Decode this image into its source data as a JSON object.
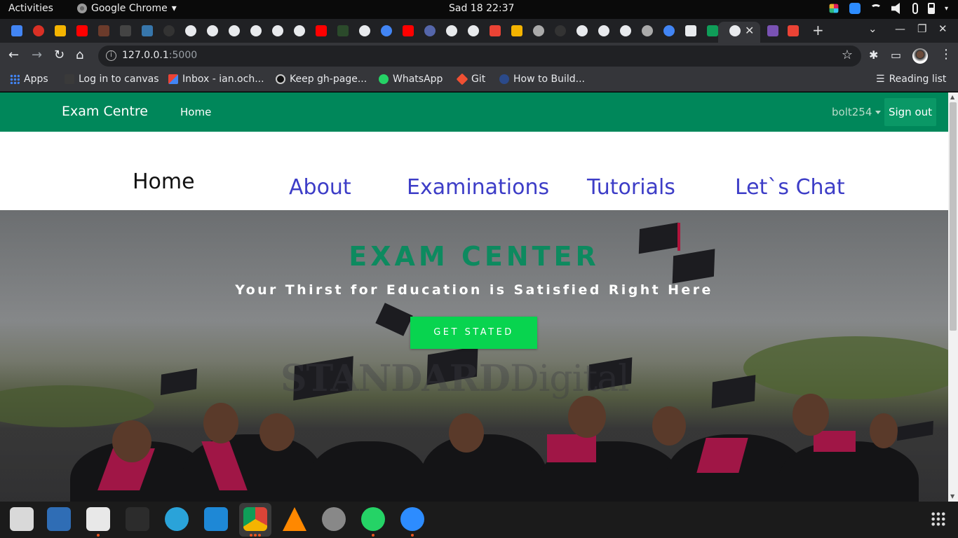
{
  "system": {
    "activities": "Activities",
    "app_name": "Google Chrome",
    "clock": "Sad 18  22:37"
  },
  "browser": {
    "url_host": "127.0.0.1",
    "url_port": ":5000",
    "bookmarks": [
      {
        "label": "Apps",
        "icon": "apps-grid-icon"
      },
      {
        "label": "Log in to canvas",
        "icon": "canvas-icon"
      },
      {
        "label": "Inbox - ian.och...",
        "icon": "gmail-icon"
      },
      {
        "label": "Keep gh-page...",
        "icon": "github-icon"
      },
      {
        "label": "WhatsApp",
        "icon": "whatsapp-icon"
      },
      {
        "label": "Git",
        "icon": "git-icon"
      },
      {
        "label": "How to Build...",
        "icon": "site-icon"
      }
    ],
    "reading_list": "Reading list"
  },
  "site": {
    "brand": "Exam Centre",
    "nav_home": "Home",
    "username": "bolt254",
    "sign_out": "Sign out",
    "secondary_nav": [
      "Home",
      "About",
      "Examinations",
      "Tutorials",
      "Let`s Chat"
    ],
    "hero": {
      "title": "EXAM CENTER",
      "subtitle": "Your Thirst for Education is Satisfied Right Here",
      "cta": "GET STATED",
      "watermark_bold": "STANDARD",
      "watermark_light": "Digital"
    }
  },
  "colors": {
    "navbar": "#00875a",
    "hero_title": "#0d8a5f",
    "cta": "#08d44f",
    "nav_link": "#3d3dc7"
  }
}
